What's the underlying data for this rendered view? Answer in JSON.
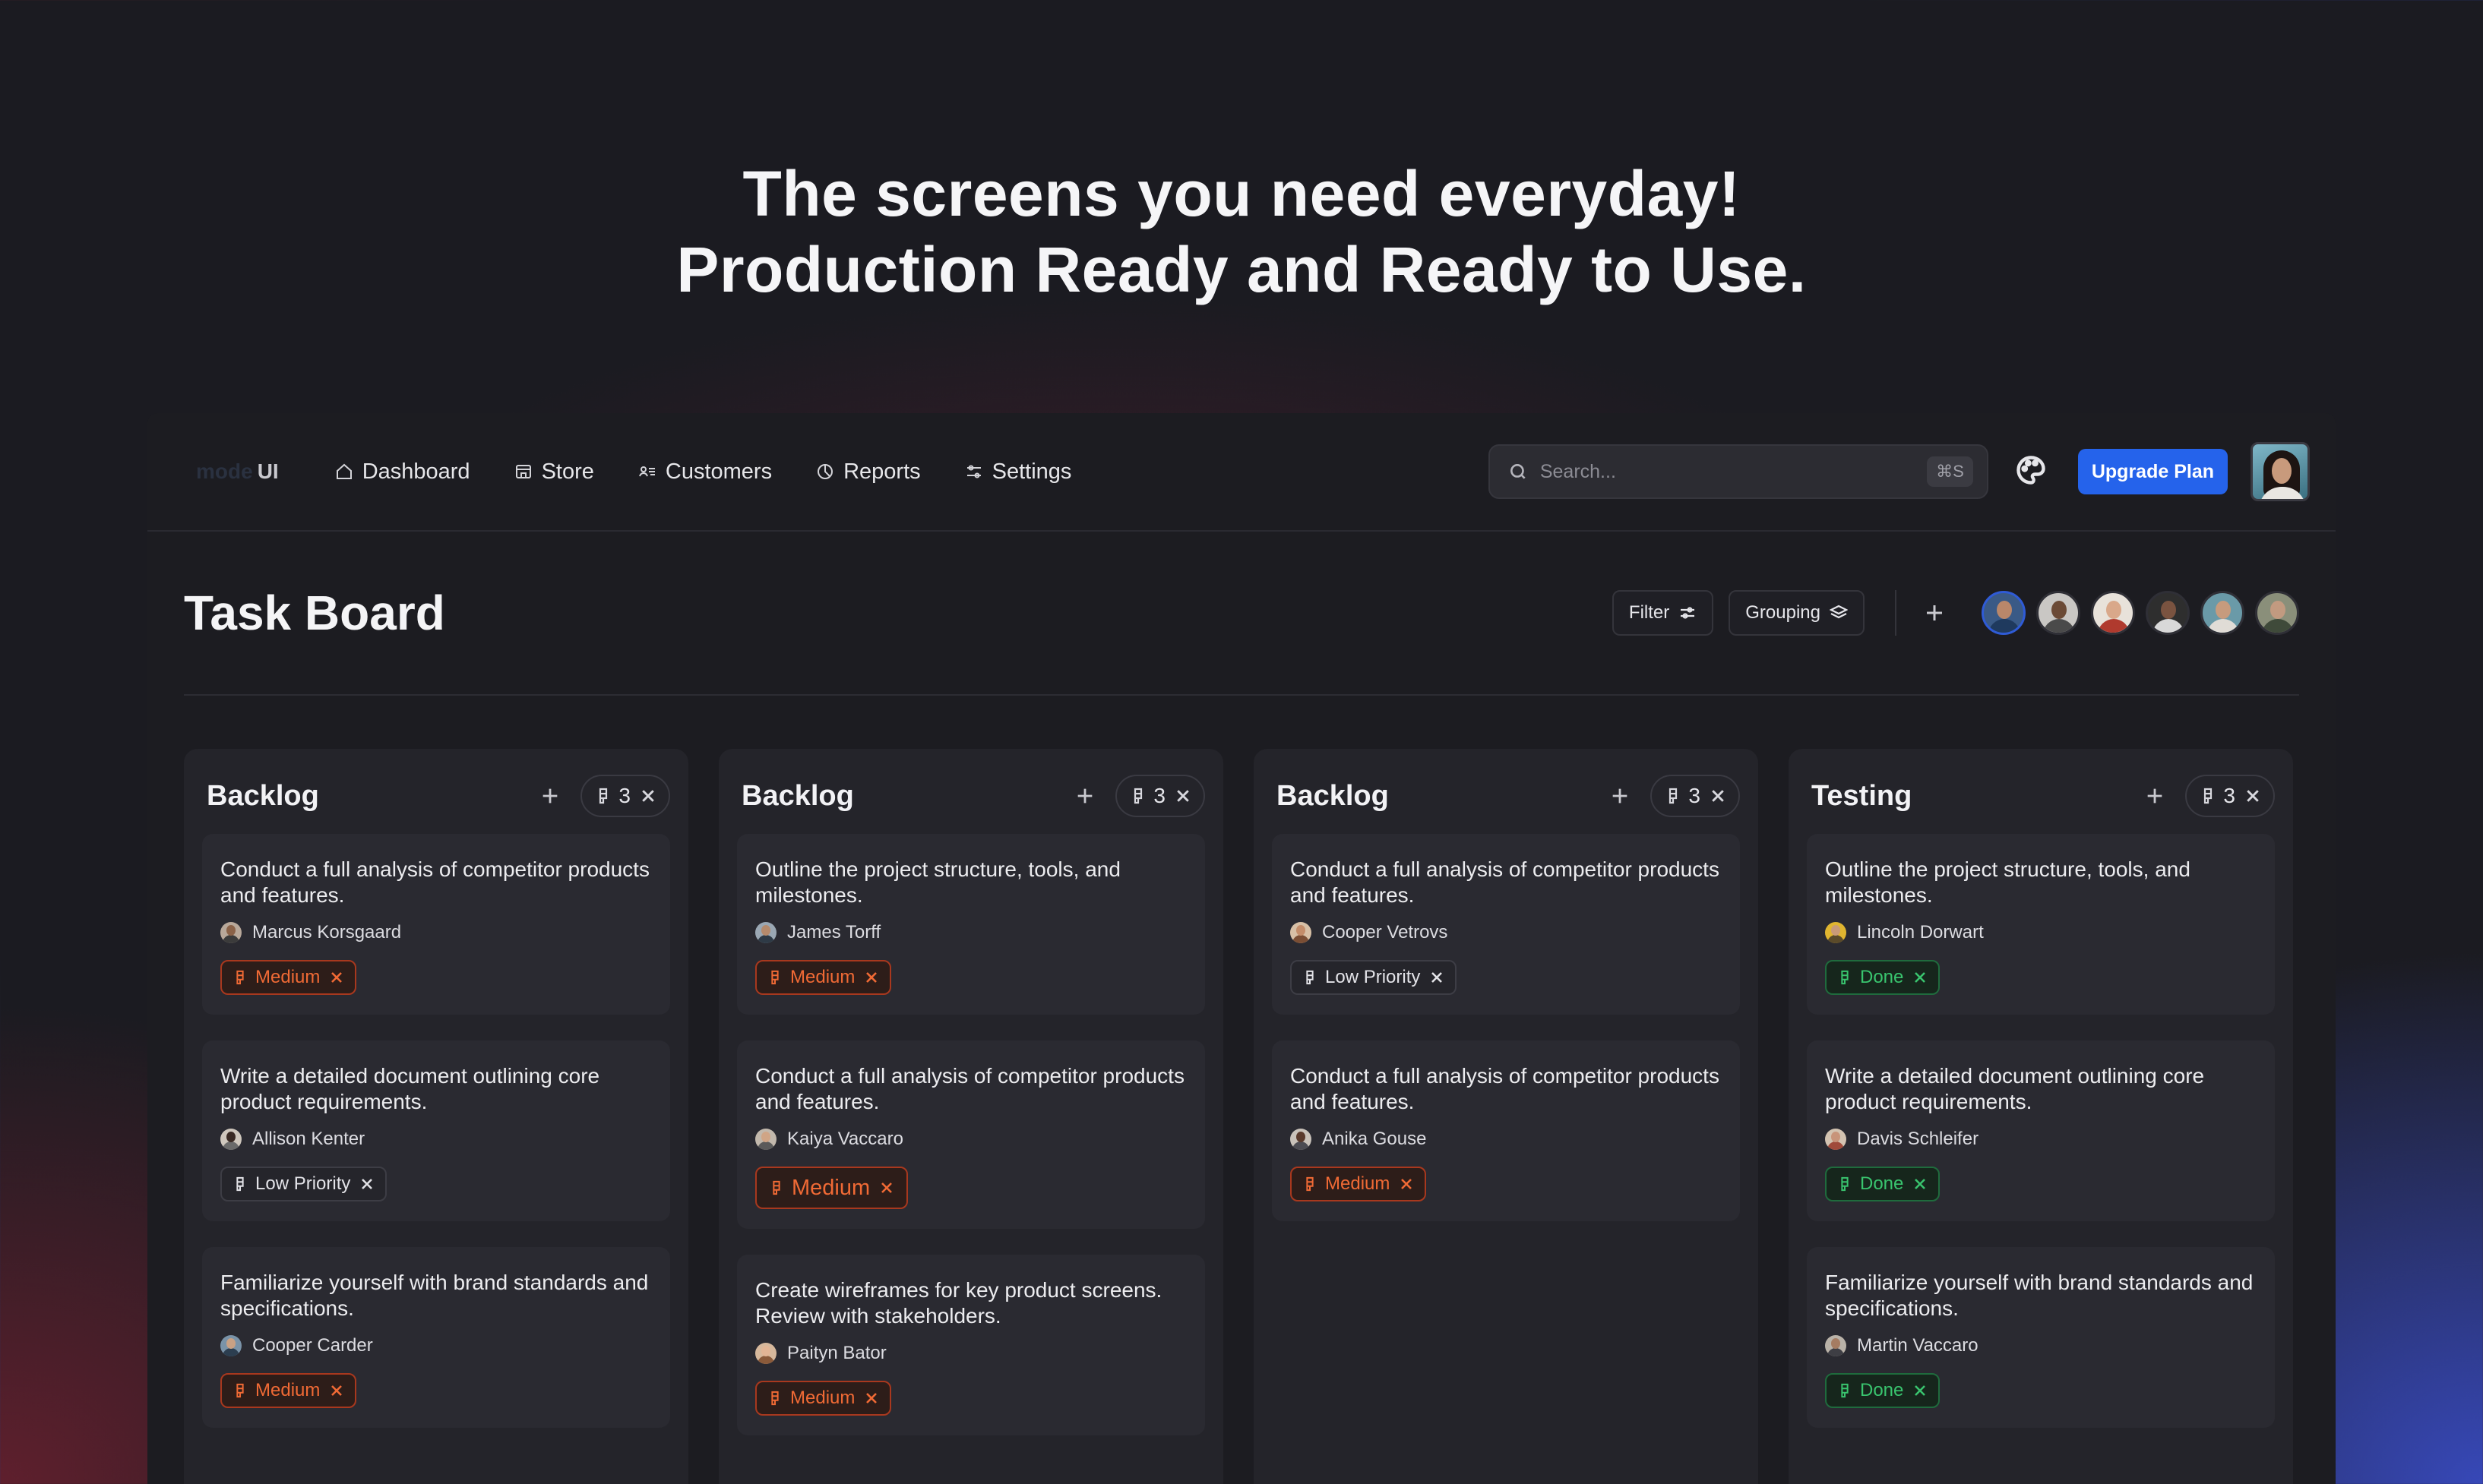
{
  "hero": {
    "line1": "The screens you need everyday!",
    "line2": "Production Ready and Ready to Use."
  },
  "nav": {
    "logo_dim": "mode",
    "logo_ui": "UI",
    "items": [
      {
        "label": "Dashboard",
        "icon": "home-icon"
      },
      {
        "label": "Store",
        "icon": "store-icon"
      },
      {
        "label": "Customers",
        "icon": "customers-icon"
      },
      {
        "label": "Reports",
        "icon": "pie-chart-icon"
      },
      {
        "label": "Settings",
        "icon": "sliders-icon"
      }
    ],
    "search_placeholder": "Search...",
    "search_shortcut": "⌘S",
    "upgrade_label": "Upgrade Plan"
  },
  "board": {
    "title": "Task Board",
    "filter_label": "Filter",
    "grouping_label": "Grouping",
    "columns": [
      {
        "title": "Backlog",
        "count": "3",
        "cards": [
          {
            "text": "Conduct a full analysis of competitor products and features.",
            "assignee": "Marcus Korsgaard",
            "tag": "Medium"
          },
          {
            "text": "Write a detailed document outlining core product requirements.",
            "assignee": "Allison Kenter",
            "tag": "Low Priority"
          },
          {
            "text": "Familiarize yourself with brand standards and specifications.",
            "assignee": "Cooper Carder",
            "tag": "Medium"
          }
        ]
      },
      {
        "title": "Backlog",
        "count": "3",
        "cards": [
          {
            "text": "Outline the project structure, tools, and milestones.",
            "assignee": "James Torff",
            "tag": "Medium"
          },
          {
            "text": "Conduct a full analysis of competitor products and features.",
            "assignee": "Kaiya Vaccaro",
            "tag": "Medium"
          },
          {
            "text": "Create wireframes for key product screens. Review with stakeholders.",
            "assignee": "Paityn Bator",
            "tag": "Medium"
          }
        ]
      },
      {
        "title": "Backlog",
        "count": "3",
        "cards": [
          {
            "text": "Conduct a full analysis of competitor products and features.",
            "assignee": "Cooper Vetrovs",
            "tag": "Low Priority"
          },
          {
            "text": "Conduct a full analysis of competitor products and features.",
            "assignee": "Anika Gouse",
            "tag": "Medium"
          }
        ]
      },
      {
        "title": "Testing",
        "count": "3",
        "cards": [
          {
            "text": "Outline the project structure, tools, and milestones.",
            "assignee": "Lincoln Dorwart",
            "tag": "Done"
          },
          {
            "text": "Write a detailed document outlining core product requirements.",
            "assignee": "Davis Schleifer",
            "tag": "Done"
          },
          {
            "text": "Familiarize yourself with brand standards and specifications.",
            "assignee": "Martin Vaccaro",
            "tag": "Done"
          }
        ]
      }
    ]
  },
  "colors": {
    "accent": "#2563eb",
    "medium": "#f06a35",
    "done": "#39c46e"
  }
}
